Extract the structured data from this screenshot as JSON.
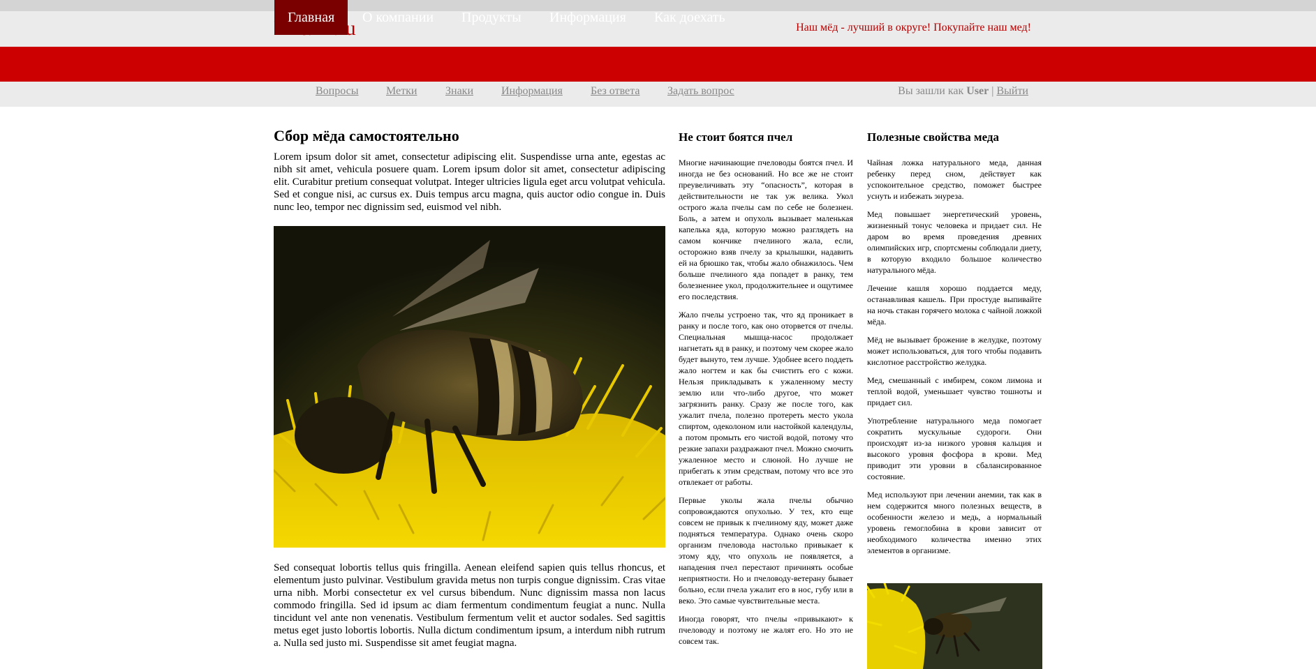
{
  "site": {
    "logo": "Пчёлы.ru",
    "slogan": "Наш мёд - лучший в округе! Покупайте наш мед!"
  },
  "nav": {
    "items": [
      "Главная",
      "О компании",
      "Продукты",
      "Информация",
      "Как доехать"
    ],
    "active_index": 0
  },
  "subnav": {
    "links": [
      "Вопросы",
      "Метки",
      "Знаки",
      "Информация",
      "Без ответа",
      "Задать вопрос"
    ],
    "user_prefix": "Вы зашли как",
    "username": "User",
    "separator": "|",
    "logout": "Выйти"
  },
  "main": {
    "title": "Сбор мёда самостоятельно",
    "intro": "Lorem ipsum dolor sit amet, consectetur adipiscing elit. Suspendisse urna ante, egestas ac nibh sit amet, vehicula posuere quam. Lorem ipsum dolor sit amet, consectetur adipiscing elit. Curabitur pretium consequat volutpat. Integer ultricies ligula eget arcu volutpat vehicula. Sed et congue nisi, ac cursus ex. Duis tempus arcu magna, quis auctor odio congue in. Duis nunc leo, tempor nec dignissim sed, euismod vel nibh.",
    "body": "Sed consequat lobortis tellus quis fringilla. Aenean eleifend sapien quis tellus rhoncus, et elementum justo pulvinar. Vestibulum gravida metus non turpis congue dignissim. Cras vitae urna nibh. Morbi consectetur ex vel cursus bibendum. Nunc dignissim massa non lacus commodo fringilla. Sed id ipsum ac diam fermentum condimentum feugiat a nunc. Nulla tincidunt vel ante non venenatis. Vestibulum fermentum velit et auctor sodales. Sed sagittis metus eget justo lobortis lobortis. Nulla dictum condimentum ipsum, a interdum nibh rutrum a. Nulla sed justo mi. Suspendisse sit amet feugiat magna."
  },
  "side1": {
    "title": "Не стоит боятся пчел",
    "paragraphs": [
      "Многие начинающие пчеловоды боятся пчел. И иногда не без оснований. Но все же не стоит преувеличивать эту “опасность”, которая в действительности не так уж велика. Укол острого жала пчелы сам по себе не болезнен. Боль, а затем и опухоль вызывает маленькая капелька яда, которую можно разглядеть на самом кончике пчелиного жала, если, осторожно взяв пчелу за крылышки, надавить ей на брюшко так, чтобы жало обнажилось. Чем больше пчелиного яда попадет в ранку, тем болезненнее укол, продолжительнее и ощутимее его последствия.",
      "Жало пчелы устроено так, что яд проникает в ранку и после того, как оно оторвется от пчелы. Специальная мышца-насос продолжает нагнетать яд в ранку, и поэтому чем скорее жало будет вынуто, тем лучше. Удобнее всего поддеть жало ногтем и как бы счистить его с кожи. Нельзя прикладывать к ужаленному месту землю или что-либо другое, что может загрязнить ранку. Сразу же после того, как ужалит пчела, полезно протереть место укола спиртом, одеколоном или настойкой календулы, а потом промыть его чистой водой, потому что резкие запахи раздражают пчел. Можно смочить ужаленное место и слюной. Но лучше не прибегать к этим средствам, потому что все это отвлекает от работы.",
      "Первые уколы жала пчелы обычно сопровождаются опухолью. У тех, кто еще совсем не привык к пчелиному яду, может даже подняться температура. Однако очень скоро организм пчеловода настолько привыкает к этому яду, что опухоль не появляется, а нападения пчел перестают причинять особые неприятности. Но и пчеловоду-ветерану бывает больно, если пчела ужалит его в нос, губу или в веко. Это самые чувствительные места.",
      "Иногда говорят, что пчелы «привыкают» к пчеловоду и поэтому не жалят его. Но это не совсем так."
    ]
  },
  "side2": {
    "title": "Полезные свойства меда",
    "paragraphs": [
      "Чайная ложка натурального меда, данная ребенку перед сном, действует как успокоительное средство, поможет быстрее уснуть и избежать энуреза.",
      "Мед повышает энергетический уровень, жизненный тонус человека и придает сил. Не даром во время проведения древних олимпийских игр, спортсмены соблюдали диету, в которую входило большое количество натурального мёда.",
      "Лечение кашля хорошо поддается меду, останавливая кашель. При простуде выпивайте на ночь стакан горячего молока с чайной ложкой мёда.",
      "Мёд не вызывает брожение в желудке, поэтому может использоваться, для того чтобы подавить кислотное расстройство желудка.",
      "Мед, смешанный с имбирем, соком лимона и теплой водой, уменьшает чувство тошноты и придает сил.",
      "Употребление натурального меда помогает сократить мускульные судороги. Они происходят из-за низкого уровня кальция и высокого уровня фосфора в крови. Мед приводит эти уровни в сбалансированное состояние.",
      "Мед используют при лечении анемии, так как в нем содержится много полезных веществ, в особенности железо и медь, а нормальный уровень гемоглобина в крови зависит от необходимого количества именно этих элементов в организме."
    ]
  },
  "colors": {
    "brand_red": "#cc0000",
    "nav_active": "#7a0000",
    "logo_red": "#b30000",
    "header_gray": "#ebebeb"
  }
}
